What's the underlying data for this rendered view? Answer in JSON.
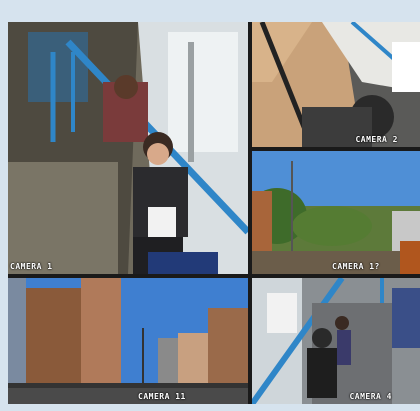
{
  "cameras": [
    {
      "id": "cam1",
      "label": "CAMERA 1"
    },
    {
      "id": "cam2",
      "label": "CAMERA 2"
    },
    {
      "id": "cam3",
      "label": "CAMERA 1?"
    },
    {
      "id": "cam11",
      "label": "CAMERA 11"
    },
    {
      "id": "cam4",
      "label": "CAMERA 4"
    }
  ]
}
